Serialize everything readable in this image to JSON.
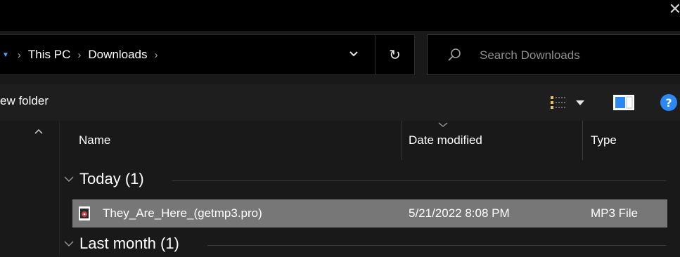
{
  "window": {
    "close_glyph": "✕"
  },
  "address": {
    "crumbs": [
      "This PC",
      "Downloads"
    ],
    "separator": "›"
  },
  "search": {
    "placeholder": "Search Downloads"
  },
  "toolbar": {
    "new_folder": "ew folder"
  },
  "columns": [
    {
      "label": "Name"
    },
    {
      "label": "Date modified"
    },
    {
      "label": "Type"
    }
  ],
  "groups": [
    {
      "label": "Today (1)"
    },
    {
      "label": "Last month (1)"
    }
  ],
  "files": [
    {
      "name": "They_Are_Here_(getmp3.pro)",
      "date": "5/21/2022 8:08 PM",
      "type": "MP3 File",
      "icon": "mp3-file-icon"
    }
  ],
  "colors": {
    "background": "#191919",
    "selection": "#777777",
    "help_accent": "#2b88f3"
  },
  "icons": {
    "help": "?",
    "refresh": "↻"
  }
}
